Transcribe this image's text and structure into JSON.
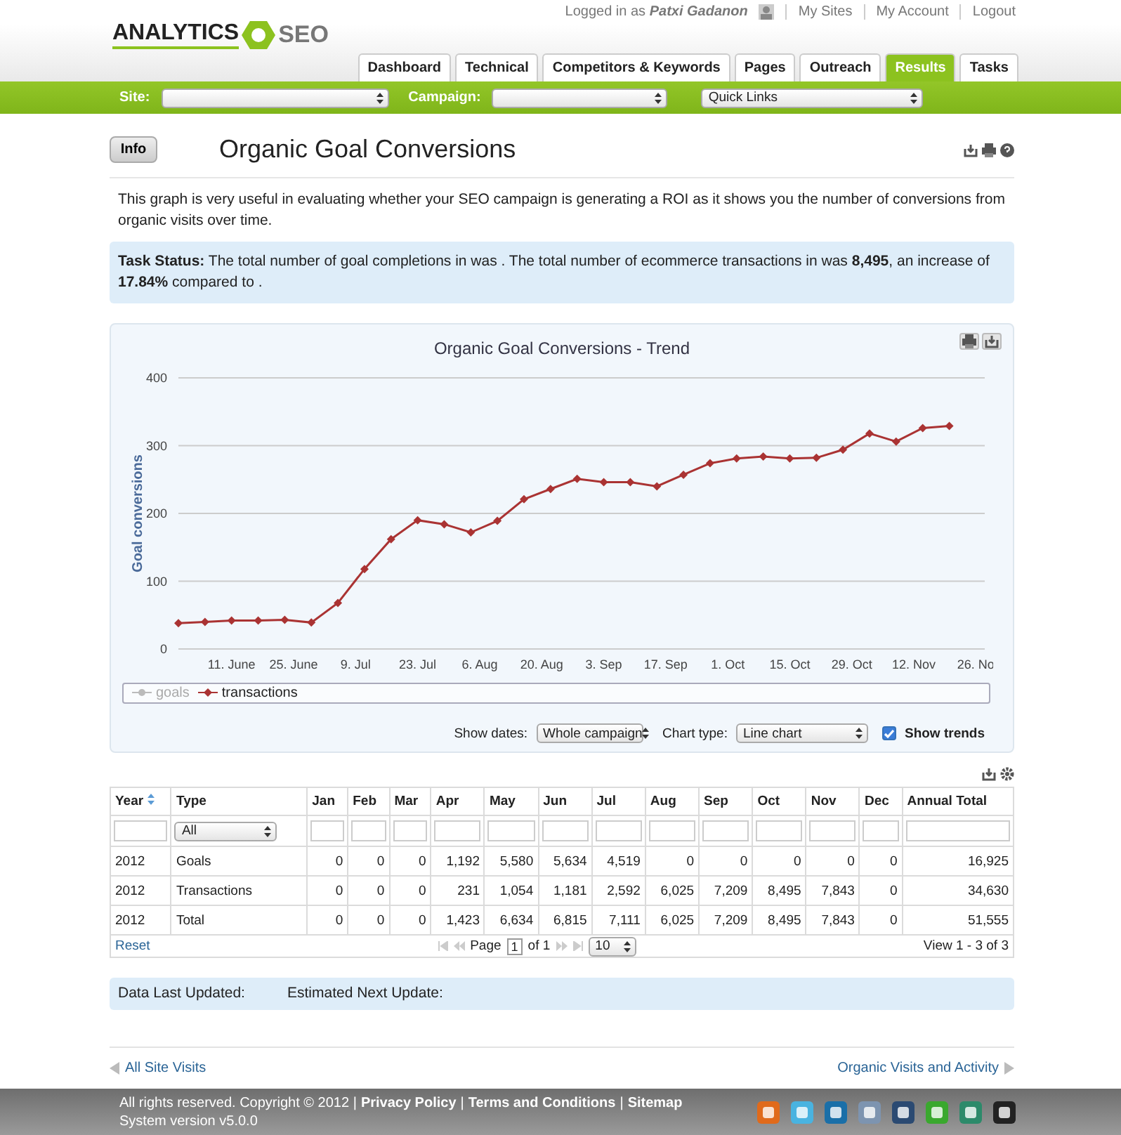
{
  "header": {
    "logo_left": "ANALYTICS",
    "logo_right": "SEO",
    "logged_in_prefix": "Logged in as",
    "user_name": "Patxi Gadanon",
    "links": [
      "My Sites",
      "My Account",
      "Logout"
    ]
  },
  "tabs": [
    {
      "label": "Dashboard",
      "selected": false
    },
    {
      "label": "Technical",
      "selected": false
    },
    {
      "label": "Competitors & Keywords",
      "selected": false
    },
    {
      "label": "Pages",
      "selected": false
    },
    {
      "label": "Outreach",
      "selected": false
    },
    {
      "label": "Results",
      "selected": true
    },
    {
      "label": "Tasks",
      "selected": false
    }
  ],
  "filter_bar": {
    "site_label": "Site:",
    "campaign_label": "Campaign:",
    "quick_links": "Quick Links"
  },
  "page": {
    "info_button": "Info",
    "title": "Organic Goal Conversions",
    "description": "This graph is very useful in evaluating whether your SEO campaign is generating a ROI as it shows you the number of conversions from organic visits over time.",
    "task_status": "**Task Status:** The total number of goal completions in  was . The total number of ecommerce transactions in  was **8,495**, an increase of **17.84%** compared to ."
  },
  "chart": {
    "legend": [
      {
        "label": "goals",
        "visible": false
      }
    ],
    "controls": {
      "dates_label": "Show dates:",
      "dates_value": "Whole campaign",
      "type_label": "Chart type:",
      "type_value": "Line chart",
      "trends_label": "Show trends",
      "trends_checked": true
    },
    "chart_data": {
      "type": "line",
      "title": "Organic Goal Conversions - Trend",
      "ylabel": "Goal conversions",
      "grid": true,
      "xlim": [
        "2012-05-30",
        "2012-11-28"
      ],
      "ylim": [
        0,
        400
      ],
      "x": [
        "2012-05-30",
        "2012-06-05",
        "2012-06-11",
        "2012-06-17",
        "2012-06-23",
        "2012-06-29",
        "2012-07-05",
        "2012-07-11",
        "2012-07-17",
        "2012-07-23",
        "2012-07-29",
        "2012-08-04",
        "2012-08-10",
        "2012-08-16",
        "2012-08-22",
        "2012-08-28",
        "2012-09-03",
        "2012-09-09",
        "2012-09-15",
        "2012-09-21",
        "2012-09-27",
        "2012-10-03",
        "2012-10-09",
        "2012-10-15",
        "2012-10-21",
        "2012-10-27",
        "2012-11-02",
        "2012-11-08",
        "2012-11-14",
        "2012-11-20"
      ],
      "series": [
        {
          "name": "transactions",
          "color": "#aa3333",
          "marker": "diamond",
          "values": [
            38,
            40,
            42,
            42,
            43,
            39,
            68,
            118,
            162,
            190,
            184,
            172,
            189,
            221,
            236,
            251,
            246,
            246,
            240,
            257,
            274,
            281,
            284,
            281,
            282,
            294,
            318,
            306,
            326,
            329
          ]
        }
      ],
      "xticks": [
        {
          "value": "2012-06-11",
          "label": "11. June"
        },
        {
          "value": "2012-06-25",
          "label": "25. June"
        },
        {
          "value": "2012-07-09",
          "label": "9. Jul"
        },
        {
          "value": "2012-07-23",
          "label": "23. Jul"
        },
        {
          "value": "2012-08-06",
          "label": "6. Aug"
        },
        {
          "value": "2012-08-20",
          "label": "20. Aug"
        },
        {
          "value": "2012-09-03",
          "label": "3. Sep"
        },
        {
          "value": "2012-09-17",
          "label": "17. Sep"
        },
        {
          "value": "2012-10-01",
          "label": "1. Oct"
        },
        {
          "value": "2012-10-15",
          "label": "15. Oct"
        },
        {
          "value": "2012-10-29",
          "label": "29. Oct"
        },
        {
          "value": "2012-11-12",
          "label": "12. Nov"
        },
        {
          "value": "2012-11-26",
          "label": "26. No"
        }
      ],
      "yticks": [
        0,
        100,
        200,
        300,
        400
      ]
    }
  },
  "table": {
    "columns": [
      {
        "label": "Year",
        "sorted": true
      },
      {
        "label": "Type",
        "sorted": false
      },
      {
        "label": "Jan",
        "sorted": false
      },
      {
        "label": "Feb",
        "sorted": false
      },
      {
        "label": "Mar",
        "sorted": false
      },
      {
        "label": "Apr",
        "sorted": false
      },
      {
        "label": "May",
        "sorted": false
      },
      {
        "label": "Jun",
        "sorted": false
      },
      {
        "label": "Jul",
        "sorted": false
      },
      {
        "label": "Aug",
        "sorted": false
      },
      {
        "label": "Sep",
        "sorted": false
      },
      {
        "label": "Oct",
        "sorted": false
      },
      {
        "label": "Nov",
        "sorted": false
      },
      {
        "label": "Dec",
        "sorted": false
      },
      {
        "label": "Annual Total",
        "sorted": false
      }
    ],
    "type_filter": "All",
    "rows": [
      [
        "2012",
        "Goals",
        "0",
        "0",
        "0",
        "1,192",
        "5,580",
        "5,634",
        "4,519",
        "0",
        "0",
        "0",
        "0",
        "0",
        "16,925"
      ],
      [
        "2012",
        "Transactions",
        "0",
        "0",
        "0",
        "231",
        "1,054",
        "1,181",
        "2,592",
        "6,025",
        "7,209",
        "8,495",
        "7,843",
        "0",
        "34,630"
      ],
      [
        "2012",
        "Total",
        "0",
        "0",
        "0",
        "1,423",
        "6,634",
        "6,815",
        "7,111",
        "6,025",
        "7,209",
        "8,495",
        "7,843",
        "0",
        "51,555"
      ]
    ],
    "pager": {
      "reset": "Reset",
      "page_label": "Page",
      "page_value": "1",
      "of_label": "of 1",
      "page_size": "10",
      "view": "View 1 - 3 of 3"
    }
  },
  "updates": {
    "last_label": "Data Last Updated:",
    "next_label": "Estimated Next Update:"
  },
  "nav": {
    "previous": "All Site Visits",
    "next": "Organic Visits and Activity"
  },
  "footer": {
    "copyright": "All rights reserved. Copyright © 2012 |",
    "links": [
      "Privacy Policy",
      "Terms and Conditions",
      "Sitemap"
    ],
    "separator": "|",
    "version": "System version v5.0.0"
  }
}
